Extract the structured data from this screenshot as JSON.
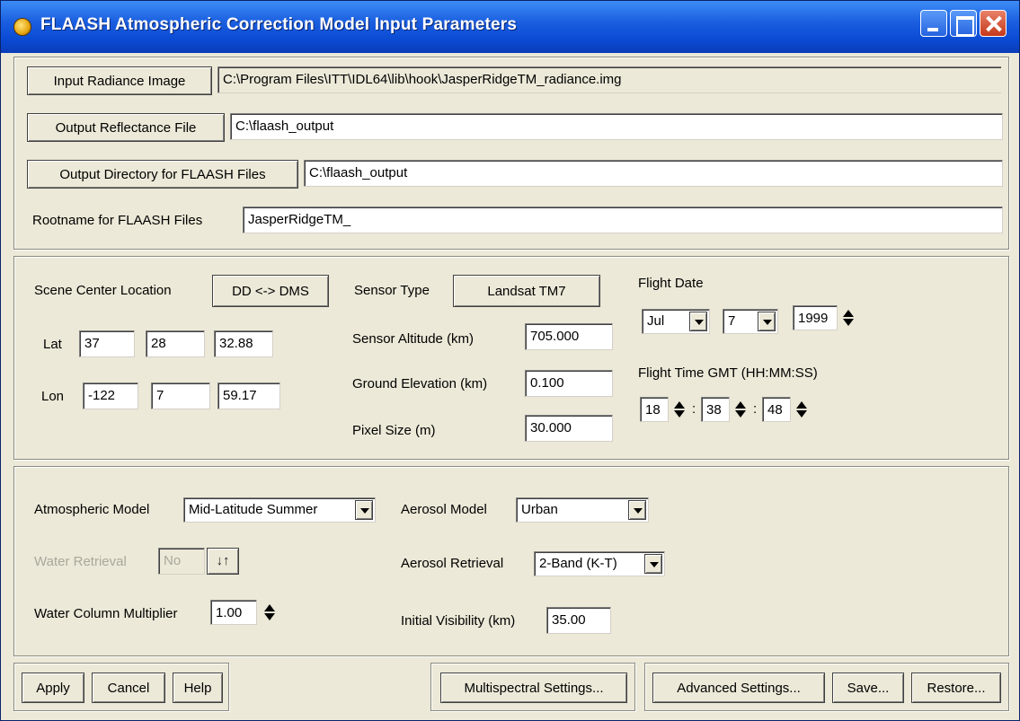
{
  "window": {
    "title": "FLAASH Atmospheric Correction Model Input Parameters"
  },
  "files": {
    "input_radiance_label": "Input Radiance Image",
    "input_radiance_value": "C:\\Program Files\\ITT\\IDL64\\lib\\hook\\JasperRidgeTM_radiance.img",
    "output_reflectance_label": "Output Reflectance File",
    "output_reflectance_value": "C:\\flaash_output",
    "output_directory_label": "Output Directory for FLAASH Files",
    "output_directory_value": "C:\\flaash_output",
    "rootname_label": "Rootname for FLAASH Files",
    "rootname_value": "JasperRidgeTM_"
  },
  "scene": {
    "center_location_label": "Scene Center Location",
    "dd_dms_button": "DD <-> DMS",
    "lat_label": "Lat",
    "lat_deg": "37",
    "lat_min": "28",
    "lat_sec": "32.88",
    "lon_label": "Lon",
    "lon_deg": "-122",
    "lon_min": "7",
    "lon_sec": "59.17"
  },
  "sensor": {
    "type_label": "Sensor Type",
    "type_button": "Landsat TM7",
    "altitude_label": "Sensor Altitude (km)",
    "altitude_value": "705.000",
    "ground_elev_label": "Ground Elevation (km)",
    "ground_elev_value": "0.100",
    "pixel_size_label": "Pixel Size (m)",
    "pixel_size_value": "30.000"
  },
  "flight": {
    "date_label": "Flight Date",
    "month": "Jul",
    "day": "7",
    "year": "1999",
    "time_label": "Flight Time GMT (HH:MM:SS)",
    "hh": "18",
    "mm": "38",
    "ss": "48",
    "sep": ":"
  },
  "atmosphere": {
    "model_label": "Atmospheric Model",
    "model_value": "Mid-Latitude Summer",
    "water_retrieval_label": "Water Retrieval",
    "water_retrieval_value": "No",
    "water_column_label": "Water Column Multiplier",
    "water_column_value": "1.00",
    "aerosol_model_label": "Aerosol Model",
    "aerosol_model_value": "Urban",
    "aerosol_retrieval_label": "Aerosol Retrieval",
    "aerosol_retrieval_value": "2-Band (K-T)",
    "visibility_label": "Initial Visibility (km)",
    "visibility_value": "35.00"
  },
  "buttons": {
    "apply": "Apply",
    "cancel": "Cancel",
    "help": "Help",
    "multispectral": "Multispectral Settings...",
    "advanced": "Advanced Settings...",
    "save": "Save...",
    "restore": "Restore..."
  },
  "icons": {
    "app": "flaash-app-icon",
    "toggle": "up-down-arrows-icon"
  }
}
